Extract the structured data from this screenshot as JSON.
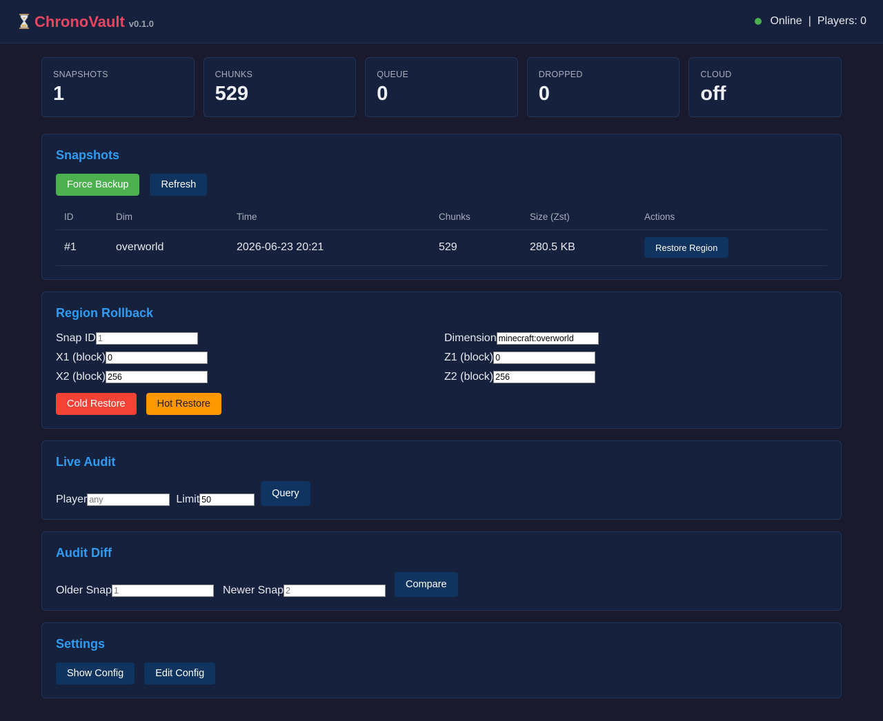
{
  "header": {
    "brand_name": "ChronoVault",
    "version": "v0.1.0",
    "status": "Online",
    "separator": "|",
    "players": "Players: 0",
    "status_color": "#4caf50",
    "icon": "hourglass-icon"
  },
  "stats": [
    {
      "label": "SNAPSHOTS",
      "value": "1"
    },
    {
      "label": "CHUNKS",
      "value": "529"
    },
    {
      "label": "QUEUE",
      "value": "0"
    },
    {
      "label": "DROPPED",
      "value": "0"
    },
    {
      "label": "CLOUD",
      "value": "off"
    }
  ],
  "snapshots": {
    "title": "Snapshots",
    "force_backup": "Force Backup",
    "refresh": "Refresh",
    "columns": [
      "ID",
      "Dim",
      "Time",
      "Chunks",
      "Size (Zst)",
      "Actions"
    ],
    "rows": [
      {
        "id": "#1",
        "dim": "overworld",
        "time": "2026-06-23 20:21",
        "chunks": "529",
        "size": "280.5 KB",
        "action": "Restore Region"
      }
    ]
  },
  "rollback": {
    "title": "Region Rollback",
    "snap_id_label": "Snap ID",
    "snap_id_placeholder": "1",
    "dimension_label": "Dimension",
    "dimension_value": "minecraft:overworld",
    "x1_label": "X1 (block)",
    "x1_value": "0",
    "z1_label": "Z1 (block)",
    "z1_value": "0",
    "x2_label": "X2 (block)",
    "x2_value": "256",
    "z2_label": "Z2 (block)",
    "z2_value": "256",
    "cold_restore": "Cold Restore",
    "hot_restore": "Hot Restore"
  },
  "audit": {
    "title": "Live Audit",
    "player_label": "Player",
    "player_placeholder": "any",
    "limit_label": "Limit",
    "limit_value": "50",
    "query": "Query"
  },
  "diff": {
    "title": "Audit Diff",
    "older_label": "Older Snap",
    "older_placeholder": "1",
    "newer_label": "Newer Snap",
    "newer_placeholder": "2",
    "compare": "Compare"
  },
  "settings": {
    "title": "Settings",
    "show_config": "Show Config",
    "edit_config": "Edit Config"
  }
}
